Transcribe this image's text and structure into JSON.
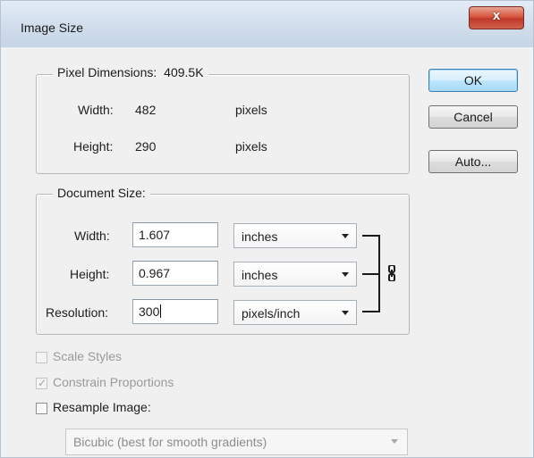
{
  "window": {
    "title": "Image Size",
    "close_glyph": "x"
  },
  "pixel_dimensions": {
    "legend": "Pixel Dimensions:",
    "size": "409.5K",
    "width_label": "Width:",
    "width_value": "482",
    "width_unit": "pixels",
    "height_label": "Height:",
    "height_value": "290",
    "height_unit": "pixels"
  },
  "document_size": {
    "legend": "Document Size:",
    "width_label": "Width:",
    "width_value": "1.607",
    "width_unit": "inches",
    "height_label": "Height:",
    "height_value": "0.967",
    "height_unit": "inches",
    "resolution_label": "Resolution:",
    "resolution_value": "300",
    "resolution_unit": "pixels/inch"
  },
  "options": {
    "scale_styles_label": "Scale Styles",
    "scale_styles_checked": false,
    "scale_styles_enabled": false,
    "constrain_label": "Constrain Proportions",
    "constrain_checked": true,
    "constrain_enabled": false,
    "resample_label": "Resample Image:",
    "resample_checked": false,
    "resample_method": "Bicubic (best for smooth gradients)"
  },
  "buttons": {
    "ok": "OK",
    "cancel": "Cancel",
    "auto": "Auto..."
  },
  "icons": {
    "close": "close-icon",
    "link": "chain-link-icon",
    "dropdown": "chevron-down-icon",
    "checkmark": "checkmark-icon"
  },
  "colors": {
    "title_bar": "#cfdceb",
    "close_button": "#c0392b",
    "default_button": "#bee6fd",
    "dialog_bg": "#f0f0f0"
  }
}
